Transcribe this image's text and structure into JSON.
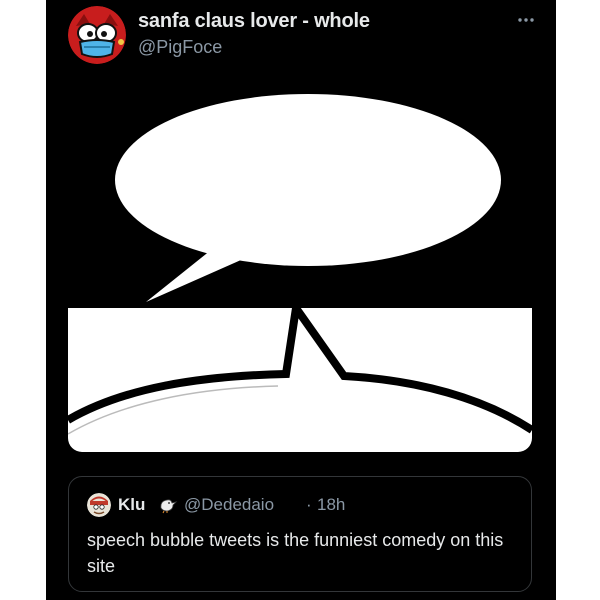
{
  "tweet": {
    "author": {
      "display_name": "sanfa claus lover - whole",
      "handle": "@PigFoce",
      "avatar_icon": "red-cartoon-face-avatar"
    },
    "more_icon": "more-dots-icon",
    "media": {
      "description_icon": "speech-bubble-image"
    }
  },
  "quote_tweet": {
    "author": {
      "display_name": "Klu",
      "badge_icon": "bird-emoji-icon",
      "handle": "@Dededaio",
      "separator": "·",
      "time": "18h",
      "avatar_icon": "cartoon-avatar"
    },
    "text": "speech bubble tweets is the funniest comedy on this site"
  },
  "colors": {
    "background": "#000000",
    "primary_text": "#e7e9ea",
    "secondary_text": "#8b98a5",
    "border": "#333639"
  }
}
